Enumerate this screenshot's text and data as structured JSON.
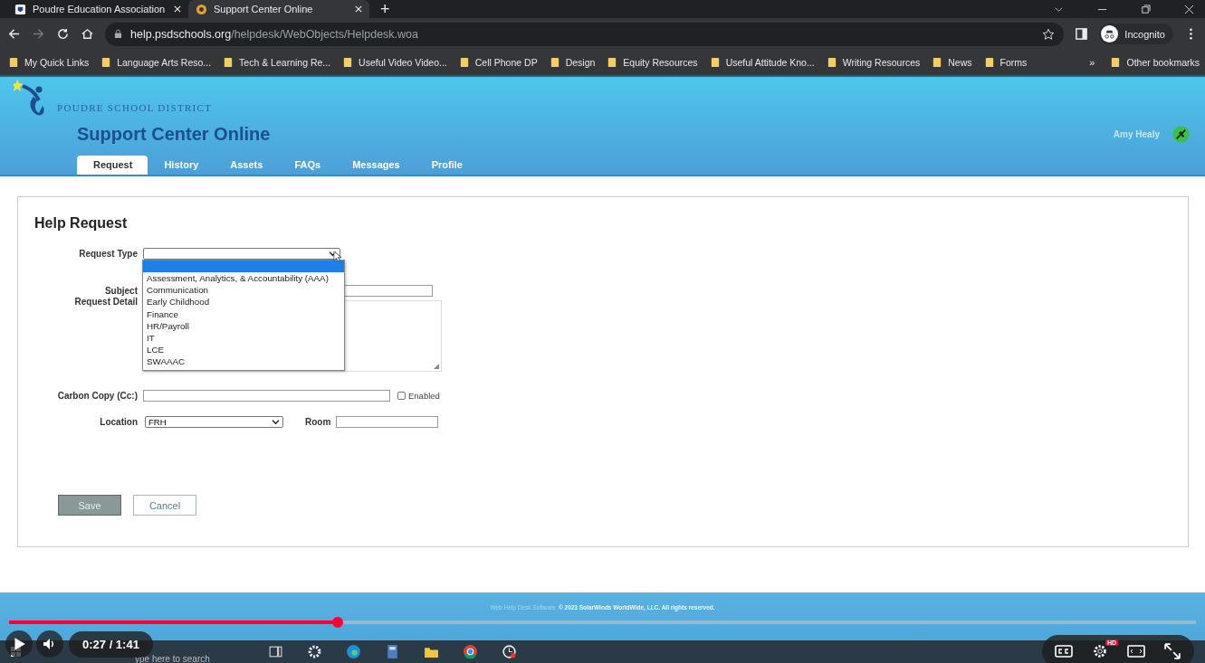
{
  "browser": {
    "tabs": [
      {
        "title": "Poudre Education Association",
        "selected": false
      },
      {
        "title": "Support Center Online",
        "selected": true
      }
    ],
    "new_tab": "+",
    "address": {
      "host": "help.psdschools.org",
      "path": "/helpdesk/WebObjects/Helpdesk.woa"
    },
    "profile": "Incognito",
    "bookmarks": [
      "My Quick Links",
      "Language Arts Reso...",
      "Tech & Learning Re...",
      "Useful Video Video...",
      "Cell Phone DP",
      "Design",
      "Equity Resources",
      "Useful Attitude Kno...",
      "Writing Resources",
      "News",
      "Forms"
    ],
    "bookmarks_more": "»",
    "other_bookmarks": "Other bookmarks"
  },
  "site": {
    "brand": "POUDRE SCHOOL DISTRICT",
    "title": "Support Center Online",
    "user": "Amy Healy",
    "nav": [
      {
        "label": "Request",
        "selected": true
      },
      {
        "label": "History",
        "selected": false
      },
      {
        "label": "Assets",
        "selected": false
      },
      {
        "label": "FAQs",
        "selected": false
      },
      {
        "label": "Messages",
        "selected": false
      },
      {
        "label": "Profile",
        "selected": false
      }
    ]
  },
  "form": {
    "title": "Help Request",
    "request_type": {
      "label": "Request Type",
      "expanded": true,
      "blank_highlighted": true,
      "options": [
        "Assessment, Analytics, & Accountability (AAA)",
        "Communication",
        "Early Childhood",
        "Finance",
        "HR/Payroll",
        "IT",
        "LCE",
        "SWAAAC"
      ]
    },
    "subject_label": "Subject",
    "detail_label": "Request Detail",
    "cc": {
      "label": "Carbon Copy (Cc:)",
      "enabled": {
        "label": "Enabled",
        "checked": false
      }
    },
    "location": {
      "label": "Location",
      "value": "FRH"
    },
    "room_label": "Room",
    "save": {
      "label": "Save",
      "disabled": true
    },
    "cancel": "Cancel"
  },
  "footer": {
    "link": "Web Help Desk Software",
    "copyright": "© 2023 SolarWinds WorldWide, LLC. All rights reserved."
  },
  "video": {
    "time": "0:27 / 1:41",
    "progress": {
      "level": 0.277
    },
    "hd_badge": "HD"
  },
  "taskbar": {
    "search_placeholder": "ype here to search"
  }
}
